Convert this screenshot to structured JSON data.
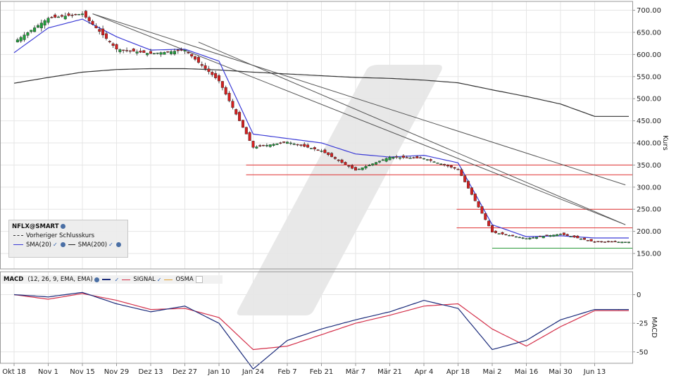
{
  "colors": {
    "up": "#1f9e3a",
    "down": "#d42020",
    "sma20": "#3b3bd6",
    "sma200": "#333333",
    "signal": "#d4304a",
    "osma": "#e0a030",
    "hline": "#e03030",
    "support": "#2a9a3a"
  },
  "price_panel": {
    "axis_title": "Kurs",
    "ticks": [
      "700.00",
      "650.00",
      "600.00",
      "550.00",
      "500.00",
      "450.00",
      "400.00",
      "350.00",
      "300.00",
      "250.00",
      "200.00",
      "150.00"
    ],
    "legend": {
      "symbol": "NFLX@SMART",
      "prev_close": "Vorheriger Schlusskurs",
      "sma20": "SMA(20)",
      "sma200": "SMA(200)"
    }
  },
  "macd_panel": {
    "axis_title": "MACD",
    "ticks": [
      "0",
      "-25",
      "-50"
    ],
    "legend": {
      "name": "MACD",
      "params": "(12, 26, 9, EMA, EMA)",
      "signal": "SIGNAL",
      "osma": "OSMA"
    }
  },
  "x_labels": [
    "Okt 18",
    "Nov 1",
    "Nov 15",
    "Nov 29",
    "Dez 13",
    "Dez 27",
    "Jan 10",
    "Jan 24",
    "Feb 7",
    "Feb 21",
    "Mär 7",
    "Mär 21",
    "Apr 4",
    "Apr 18",
    "Mai 2",
    "Mai 16",
    "Mai 30",
    "Jun 13"
  ],
  "chart_data": {
    "type": "candlestick",
    "symbol": "NFLX@SMART",
    "x": [
      "Okt 18",
      "Nov 1",
      "Nov 15",
      "Nov 29",
      "Dez 13",
      "Dez 27",
      "Jan 10",
      "Jan 24",
      "Feb 7",
      "Feb 21",
      "Mär 7",
      "Mär 21",
      "Apr 4",
      "Apr 18",
      "Mai 2",
      "Mai 16",
      "Mai 30",
      "Jun 13"
    ],
    "ylim": [
      115,
      720
    ],
    "close": [
      628,
      682,
      692,
      612,
      602,
      610,
      540,
      390,
      402,
      382,
      338,
      368,
      365,
      340,
      198,
      184,
      194,
      176
    ],
    "sma20": [
      604,
      660,
      680,
      640,
      610,
      612,
      585,
      420,
      410,
      400,
      375,
      368,
      372,
      355,
      215,
      188,
      190,
      185
    ],
    "sma200": [
      535,
      548,
      560,
      566,
      568,
      568,
      565,
      560,
      556,
      552,
      548,
      546,
      542,
      536,
      520,
      505,
      488,
      460
    ],
    "horizontal_levels": [
      350,
      328,
      250,
      208
    ],
    "support_level": 162,
    "macd": {
      "ylim": [
        -60,
        20
      ],
      "macd": [
        0,
        -2,
        2,
        -8,
        -15,
        -10,
        -25,
        -65,
        -40,
        -30,
        -22,
        -15,
        -5,
        -12,
        -48,
        -40,
        -22,
        -13
      ],
      "signal": [
        0,
        -4,
        1,
        -5,
        -13,
        -12,
        -20,
        -48,
        -45,
        -35,
        -25,
        -18,
        -10,
        -8,
        -30,
        -45,
        -28,
        -14
      ]
    }
  }
}
